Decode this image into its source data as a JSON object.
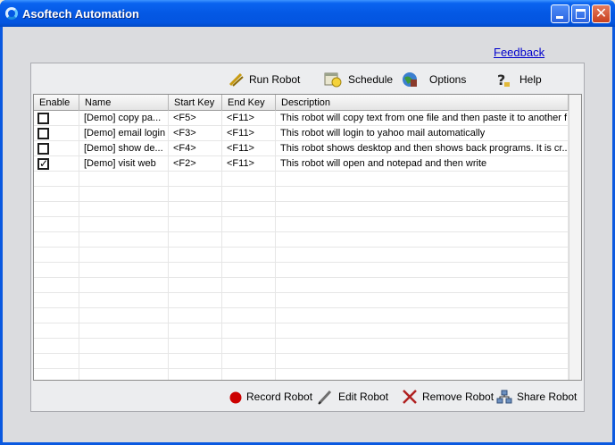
{
  "window": {
    "title": "Asoftech Automation"
  },
  "feedback_label": "Feedback",
  "toolbar": {
    "run_robot": "Run Robot",
    "schedule": "Schedule",
    "options": "Options",
    "help": "Help"
  },
  "table": {
    "columns": [
      "Enable",
      "Name",
      "Start Key",
      "End Key",
      "Description"
    ],
    "rows": [
      {
        "enabled": false,
        "name": "[Demo] copy pa...",
        "start_key": "<F5>",
        "end_key": "<F11>",
        "description": "This robot will copy text from one file and then paste it to another f..."
      },
      {
        "enabled": false,
        "name": "[Demo] email login",
        "start_key": "<F3>",
        "end_key": "<F11>",
        "description": "This robot will login to yahoo mail automatically"
      },
      {
        "enabled": false,
        "name": "[Demo] show de...",
        "start_key": "<F4>",
        "end_key": "<F11>",
        "description": "This robot shows desktop and then shows back programs. It is cr..."
      },
      {
        "enabled": true,
        "name": "[Demo] visit web",
        "start_key": "<F2>",
        "end_key": "<F11>",
        "description": "This robot will open and notepad and then write"
      }
    ]
  },
  "footer": {
    "record_robot": "Record Robot",
    "edit_robot": "Edit Robot",
    "remove_robot": "Remove Robot",
    "share_robot": "Share Robot"
  },
  "colors": {
    "accent": "#0458e4",
    "link": "#0000cc",
    "record": "#cc0000",
    "remove": "#b02020"
  }
}
